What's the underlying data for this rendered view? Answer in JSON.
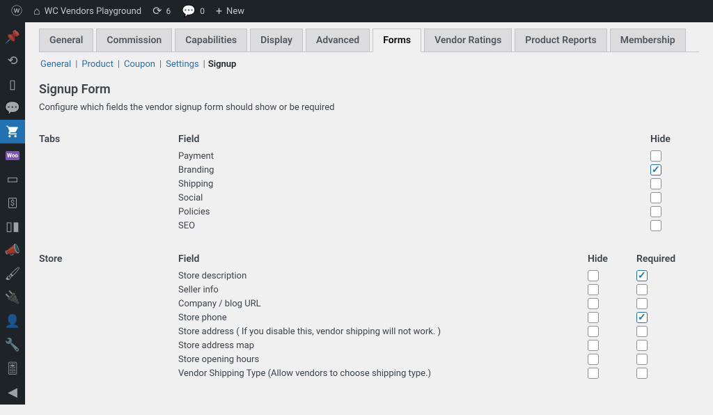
{
  "adminbar": {
    "site_name": "WC Vendors Playground",
    "updates": "6",
    "comments": "0",
    "new": "New"
  },
  "tabs": [
    {
      "label": "General",
      "active": false
    },
    {
      "label": "Commission",
      "active": false
    },
    {
      "label": "Capabilities",
      "active": false
    },
    {
      "label": "Display",
      "active": false
    },
    {
      "label": "Advanced",
      "active": false
    },
    {
      "label": "Forms",
      "active": true
    },
    {
      "label": "Vendor Ratings",
      "active": false
    },
    {
      "label": "Product Reports",
      "active": false
    },
    {
      "label": "Membership",
      "active": false
    }
  ],
  "subtabs": [
    {
      "label": "General",
      "current": false
    },
    {
      "label": "Product",
      "current": false
    },
    {
      "label": "Coupon",
      "current": false
    },
    {
      "label": "Settings",
      "current": false
    },
    {
      "label": "Signup",
      "current": true
    }
  ],
  "page": {
    "title": "Signup Form",
    "description": "Configure which fields the vendor signup form should show or be required"
  },
  "sections": {
    "tabs": {
      "label": "Tabs",
      "headers": {
        "field": "Field",
        "hide": "Hide"
      },
      "rows": [
        {
          "field": "Payment",
          "hide": false
        },
        {
          "field": "Branding",
          "hide": true
        },
        {
          "field": "Shipping",
          "hide": false
        },
        {
          "field": "Social",
          "hide": false
        },
        {
          "field": "Policies",
          "hide": false
        },
        {
          "field": "SEO",
          "hide": false
        }
      ]
    },
    "store": {
      "label": "Store",
      "headers": {
        "field": "Field",
        "hide": "Hide",
        "required": "Required"
      },
      "rows": [
        {
          "field": "Store description",
          "hide": false,
          "required": true
        },
        {
          "field": "Seller info",
          "hide": false,
          "required": false
        },
        {
          "field": "Company / blog URL",
          "hide": false,
          "required": false
        },
        {
          "field": "Store phone",
          "hide": false,
          "required": true
        },
        {
          "field": "Store address ( If you disable this, vendor shipping will not work. )",
          "hide": false,
          "required": false
        },
        {
          "field": "Store address map",
          "hide": false,
          "required": false
        },
        {
          "field": "Store opening hours",
          "hide": false,
          "required": false
        },
        {
          "field": "Vendor Shipping Type (Allow vendors to choose shipping type.)",
          "hide": false,
          "required": false
        }
      ]
    }
  }
}
